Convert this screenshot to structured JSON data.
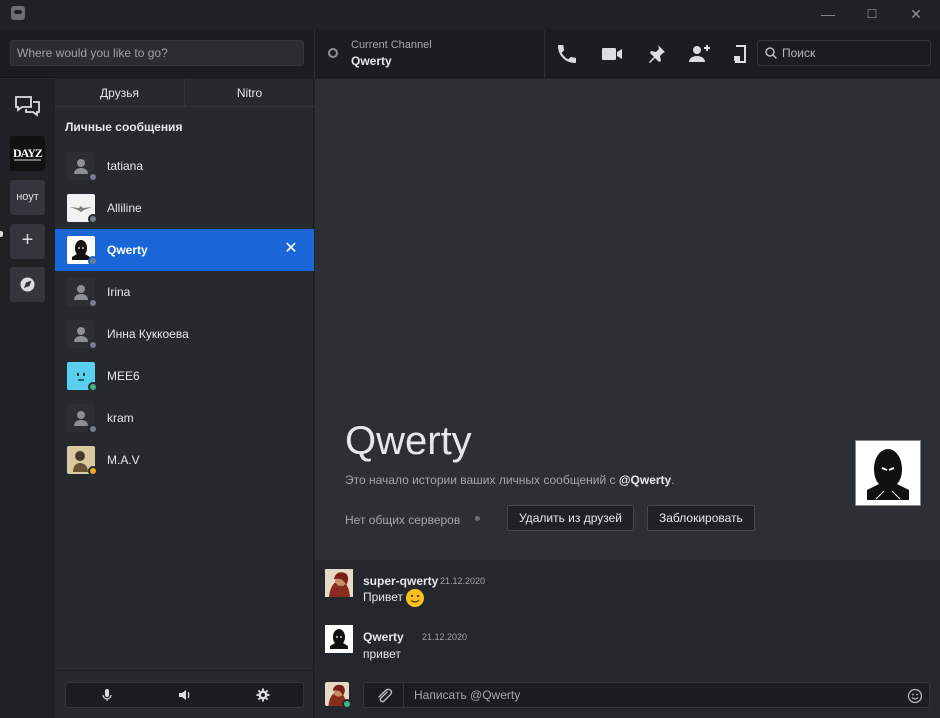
{
  "window": {
    "minimize": "—",
    "maximize": "☐",
    "close": "✕"
  },
  "topbar": {
    "goto_placeholder": "Where would you like to go?",
    "channel_label": "Current Channel",
    "channel_name": "Qwerty",
    "search_placeholder": "Поиск",
    "icons": [
      "phone-icon",
      "video-icon",
      "pin-icon",
      "add-friend-icon",
      "inbox-icon"
    ]
  },
  "rail": {
    "items": [
      {
        "name": "direct-messages",
        "label": ""
      },
      {
        "name": "server-dayz",
        "label": "DAYZ"
      },
      {
        "name": "server-hoyt",
        "label": "ноут"
      },
      {
        "name": "add-server",
        "label": "+"
      },
      {
        "name": "explore-servers",
        "label": ""
      }
    ]
  },
  "dm_panel": {
    "tabs": [
      "Друзья",
      "Nitro"
    ],
    "header": "Личные сообщения",
    "items": [
      {
        "name": "tatiana",
        "status": "#747f8d",
        "active": false
      },
      {
        "name": "Alliline",
        "status": "#747f8d",
        "active": false
      },
      {
        "name": "Qwerty",
        "status": "#747f8d",
        "active": true,
        "close": "✕"
      },
      {
        "name": "Irina",
        "status": "#747f8d",
        "active": false
      },
      {
        "name": "Инна Куккоева",
        "status": "#747f8d",
        "active": false
      },
      {
        "name": "MEE6",
        "status": "#43b581",
        "active": false
      },
      {
        "name": "kram",
        "status": "#747f8d",
        "active": false
      },
      {
        "name": "M.A.V",
        "status": "#faa61a",
        "active": false
      }
    ]
  },
  "main": {
    "hero_name": "Qwerty",
    "hero_text_prefix": "Это начало истории ваших личных сообщений с ",
    "hero_text_user": "@Qwerty",
    "hero_text_suffix": ".",
    "no_servers": "Нет общих серверов",
    "remove_friend": "Удалить из друзей",
    "block": "Заблокировать",
    "messages": [
      {
        "author": "super-qwerty",
        "time": "21.12.2020",
        "text": "Привет",
        "emoji": "slight-smile"
      },
      {
        "author": "Qwerty",
        "time": "21.12.2020",
        "text": "привет"
      }
    ],
    "composer_placeholder": "Написать @Qwerty"
  },
  "colors": {
    "accent": "#1866d7",
    "online": "#43b581",
    "idle": "#faa61a",
    "offline": "#747f8d"
  }
}
